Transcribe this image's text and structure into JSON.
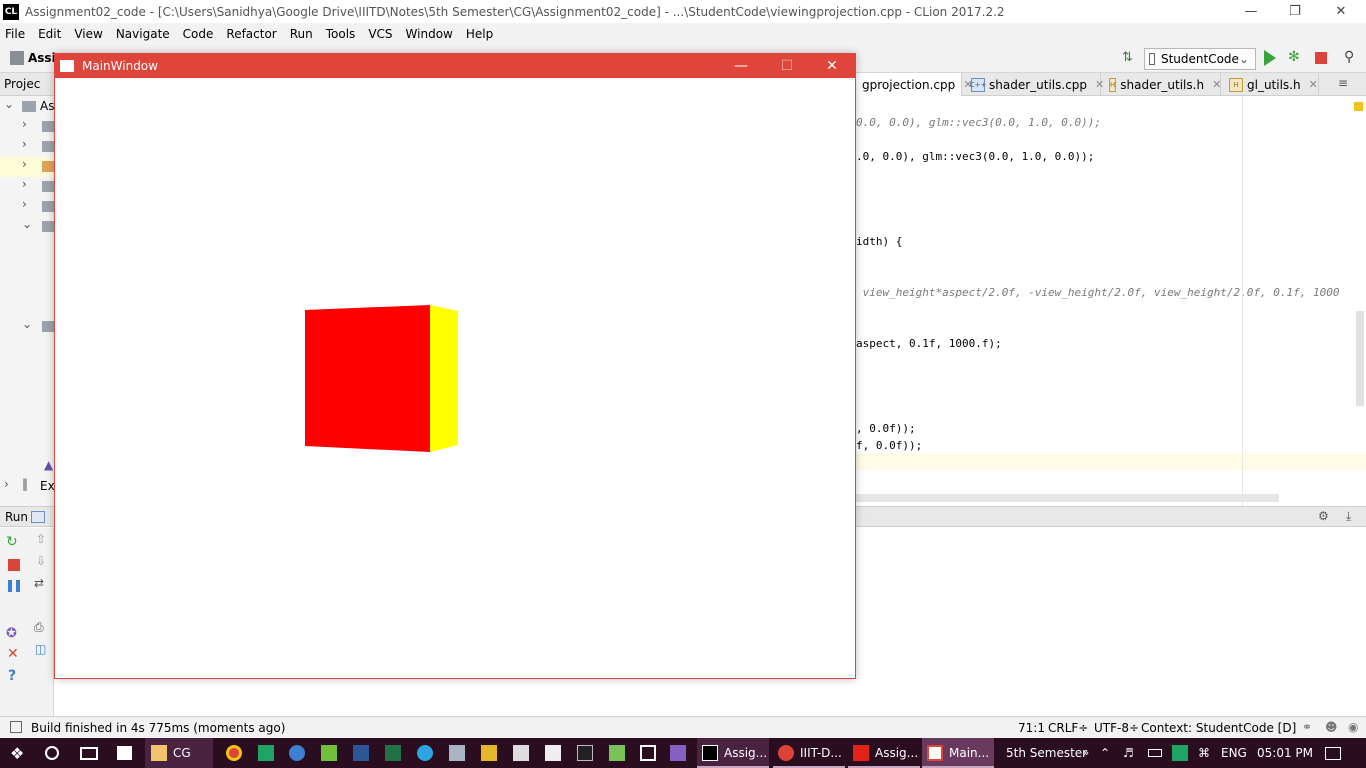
{
  "app": {
    "title": "Assignment02_code - [C:\\Users\\Sanidhya\\Google Drive\\IIITD\\Notes\\5th Semester\\CG\\Assignment02_code] - ...\\StudentCode\\viewingprojection.cpp - CLion 2017.2.2",
    "logo_text": "CL"
  },
  "menu": [
    "File",
    "Edit",
    "View",
    "Navigate",
    "Code",
    "Refactor",
    "Run",
    "Tools",
    "VCS",
    "Window",
    "Help"
  ],
  "toolbar": {
    "breadcrumb": "Assig",
    "run_config": "StudentCode"
  },
  "tabs": [
    {
      "label": "gprojection.cpp",
      "type": "cpp",
      "active": true
    },
    {
      "label": "shader_utils.cpp",
      "type": "cpp",
      "active": false
    },
    {
      "label": "shader_utils.h",
      "type": "h",
      "active": false
    },
    {
      "label": "gl_utils.h",
      "type": "h",
      "active": false
    }
  ],
  "project_panel": {
    "header": "Projec",
    "root": "Assi",
    "external": "Ext"
  },
  "code": {
    "line1": "0.0, 0.0), glm::vec3(0.0, 1.0, 0.0));",
    "line2": ".0, 0.0), glm::vec3(0.0, 1.0, 0.0));",
    "line3": "idth) {",
    "line4": " view_height*aspect/2.0f, -view_height/2.0f, view_height/2.0f, 0.1f, 1000",
    "line5": "aspect, 0.1f, 1000.f);",
    "line6": ", 0.0f));",
    "line7": "f, 0.0f));"
  },
  "run_panel": {
    "label": "Run",
    "sub": "S"
  },
  "status": {
    "message": "Build finished in 4s 775ms (moments ago)",
    "position": "71:1",
    "line_sep": "CRLF÷",
    "encoding": "UTF-8÷",
    "context": "Context: StudentCode [D]"
  },
  "main_window": {
    "title": "MainWindow",
    "cube_front_color": "#ff0000",
    "cube_side_color": "#ffff00"
  },
  "taskbar": {
    "cg_label": "CG",
    "clion_label": "Assig...",
    "chrome_label": "IIIT-D...",
    "pdf_label": "Assig...",
    "main_label": "Main...",
    "folder_label": "5th Semester",
    "lang": "ENG",
    "time": "05:01 PM"
  }
}
